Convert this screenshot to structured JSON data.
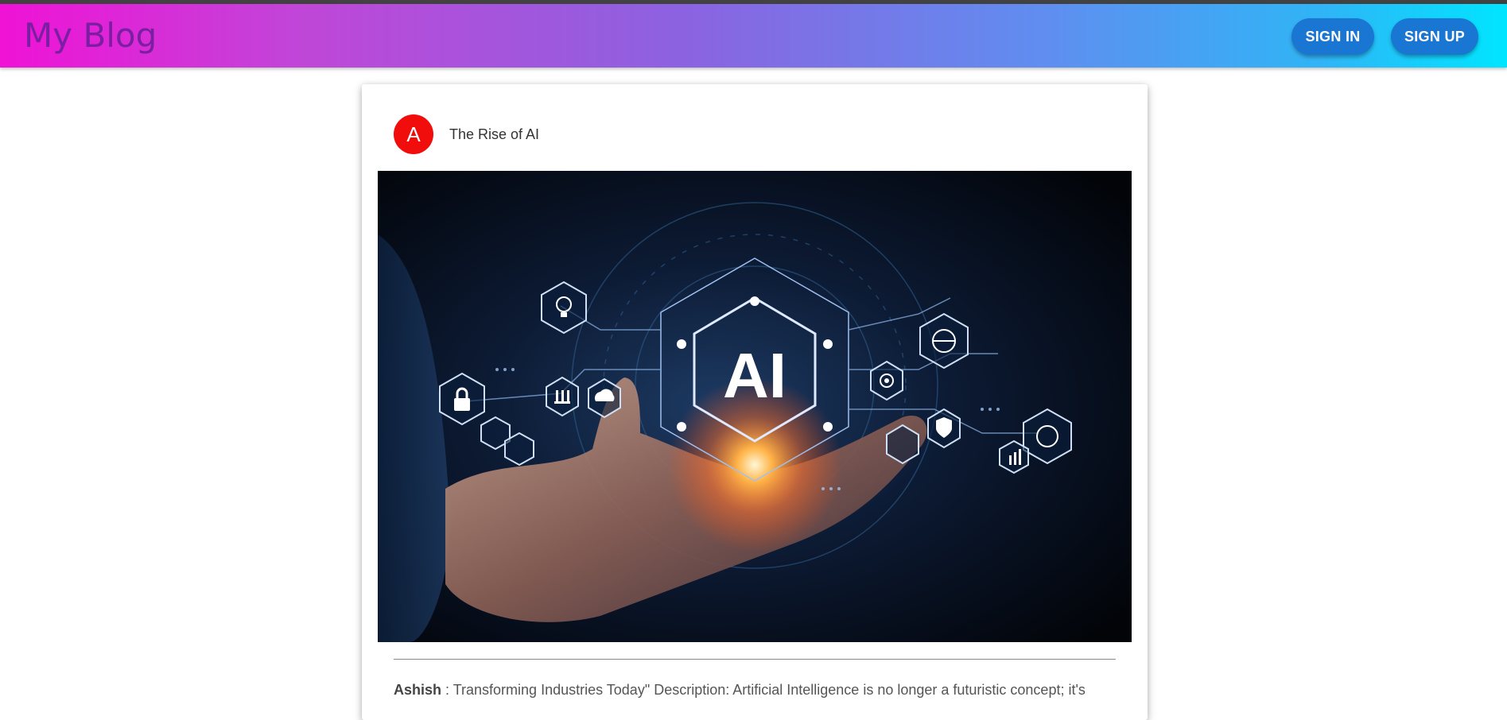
{
  "header": {
    "brand": "My Blog",
    "sign_in_label": "SIGN IN",
    "sign_up_label": "SIGN UP"
  },
  "post": {
    "avatar_letter": "A",
    "title": "The Rise of AI",
    "image_text": "AI",
    "author": "Ashish",
    "separator": " : ",
    "description": "Transforming Industries Today\" Description: Artificial Intelligence is no longer a futuristic concept; it's"
  },
  "colors": {
    "avatar_bg": "#f20d0d",
    "button_bg": "#1976d2",
    "brand_text": "#7b1fa2",
    "gradient_start": "#f012d6",
    "gradient_end": "#00e5ff"
  },
  "icons": [
    "lock-icon",
    "bulb-icon",
    "bank-icon",
    "cloud-icon",
    "globe-icon",
    "target-icon",
    "shield-icon",
    "brain-icon",
    "chart-icon",
    "handshake-icon",
    "gear-icon",
    "search-icon"
  ]
}
